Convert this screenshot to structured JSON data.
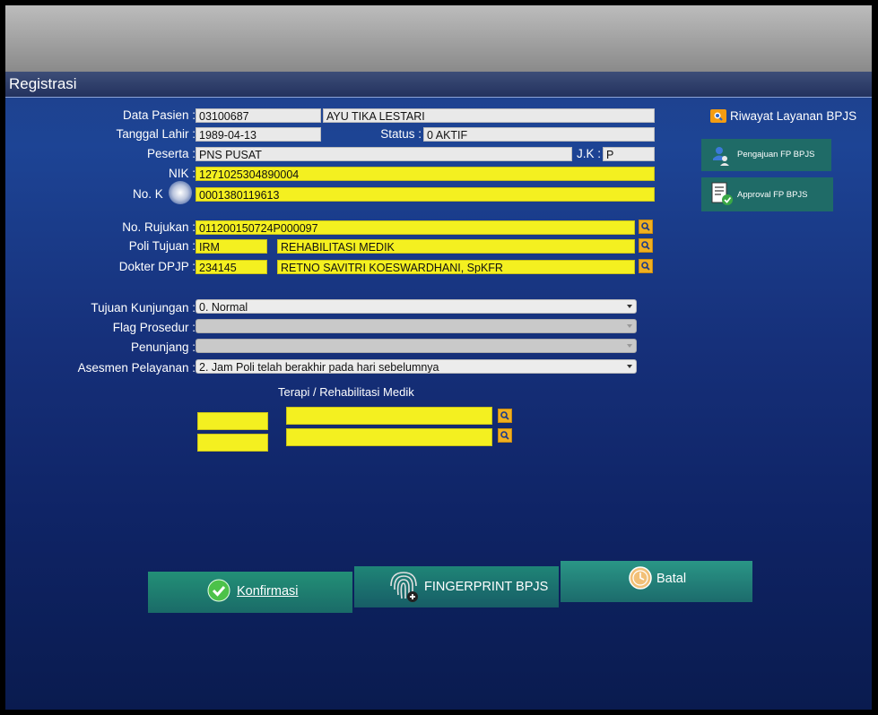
{
  "window": {
    "title": "Registrasi"
  },
  "patient": {
    "data_pasien_label": "Data Pasien :",
    "data_pasien_id": "03100687",
    "data_pasien_name": "AYU TIKA LESTARI",
    "tanggal_lahir_label": "Tanggal Lahir :",
    "tanggal_lahir": "1989-04-13",
    "status_label": "Status :",
    "status": "0 AKTIF",
    "peserta_label": "Peserta :",
    "peserta": "PNS PUSAT",
    "jk_label": "J.K :",
    "jk": "P",
    "nik_label": "NIK :",
    "nik": "1271025304890004",
    "no_kartu_label": "No. K",
    "no_kartu": "0001380119613"
  },
  "referral": {
    "no_rujukan_label": "No. Rujukan :",
    "no_rujukan": "011200150724P000097",
    "poli_tujuan_label": "Poli Tujuan :",
    "poli_tujuan_code": "IRM",
    "poli_tujuan_name": "REHABILITASI MEDIK",
    "dokter_dpjp_label": "Dokter DPJP :",
    "dokter_dpjp_code": "234145",
    "dokter_dpjp_name": "RETNO SAVITRI KOESWARDHANI, SpKFR"
  },
  "visit": {
    "tujuan_kunjungan_label": "Tujuan Kunjungan :",
    "tujuan_kunjungan": "0. Normal",
    "flag_prosedur_label": "Flag Prosedur :",
    "flag_prosedur": "",
    "penunjang_label": "Penunjang :",
    "penunjang": "",
    "asesmen_pelayanan_label": "Asesmen Pelayanan :",
    "asesmen_pelayanan": "2. Jam Poli telah berakhir pada hari sebelumnya"
  },
  "terapi": {
    "heading": "Terapi / Rehabilitasi Medik",
    "rows": [
      {
        "code": "",
        "name": ""
      },
      {
        "code": "",
        "name": ""
      }
    ]
  },
  "side_actions": {
    "riwayat_layanan": "Riwayat Layanan BPJS",
    "pengajuan_fp": "Pengajuan FP BPJS",
    "approval_fp": "Approval FP BPJS"
  },
  "actions": {
    "konfirmasi": "Konfirmasi",
    "fingerprint": "FINGERPRINT BPJS",
    "batal": "Batal"
  },
  "colors": {
    "field_yellow": "#f4f020",
    "field_white": "#e9e9e9",
    "search_button": "#f0b020",
    "action_teal": "#1f7a6a",
    "background_blue": "#1d4495"
  },
  "icons": {
    "search": "magnifier-icon",
    "riwayat": "folder-search-icon",
    "pengajuan": "users-icon",
    "approval": "document-check-icon",
    "konfirmasi": "check-circle-icon",
    "fingerprint": "fingerprint-icon",
    "batal": "clock-icon"
  }
}
